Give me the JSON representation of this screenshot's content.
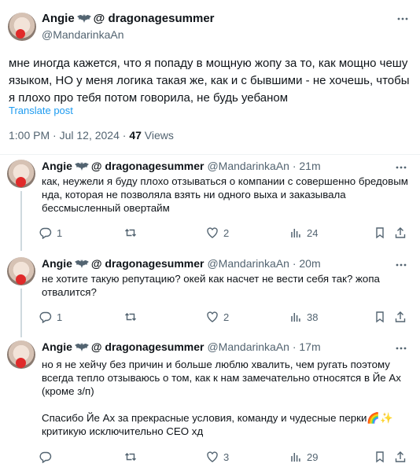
{
  "colors": {
    "accent": "#1d9bf0",
    "secondary_text": "#536471",
    "divider": "#eff3f4"
  },
  "main_tweet": {
    "display_name": "Angie",
    "name_suffix": "@ dragonagesummer",
    "handle": "@MandarinkaAn",
    "text": "мне иногда кажется, что я попаду в мощную жопу за то, как мощно чешу языком, НО у меня логика такая же, как и с бывшими - не хочешь, чтобы я плохо про тебя потом говорила, не будь уебаном",
    "translate": "Translate post",
    "time": "1:00 PM · Jul 12, 2024 · ",
    "views_count": "47",
    "views_label": " Views"
  },
  "replies": [
    {
      "display_name": "Angie",
      "name_suffix": "@ dragonagesummer",
      "handle": "@MandarinkaAn · 21m",
      "paragraphs": [
        "как, неужели я буду плохо отзываться о компании с совершенно бредовым нда, которая не позволяла взять ни одного выха и заказывала бессмысленный овертайм"
      ],
      "replies": "1",
      "reposts": "",
      "likes": "2",
      "views": "24"
    },
    {
      "display_name": "Angie",
      "name_suffix": "@ dragonagesummer",
      "handle": "@MandarinkaAn · 20m",
      "paragraphs": [
        "не хотите такую репутацию? окей как насчет не вести себя так? жопа отвалится?"
      ],
      "replies": "1",
      "reposts": "",
      "likes": "2",
      "views": "38"
    },
    {
      "display_name": "Angie",
      "name_suffix": "@ dragonagesummer",
      "handle": "@MandarinkaAn · 17m",
      "paragraphs": [
        "но я не хейчу без причин и больше люблю хвалить, чем ругать поэтому всегда тепло отзываюсь о том, как к нам замечательно относятся в Йе Ах (кроме з/п)",
        "Спасибо Йе Ах за прекрасные условия, команду и чудесные перки🌈✨ критикую исключительно CEO хд"
      ],
      "replies": "",
      "reposts": "",
      "likes": "3",
      "views": "29"
    }
  ],
  "icons": [
    "bat-icon",
    "more-icon",
    "reply-icon",
    "repost-icon",
    "like-icon",
    "views-icon",
    "bookmark-icon",
    "share-icon"
  ]
}
